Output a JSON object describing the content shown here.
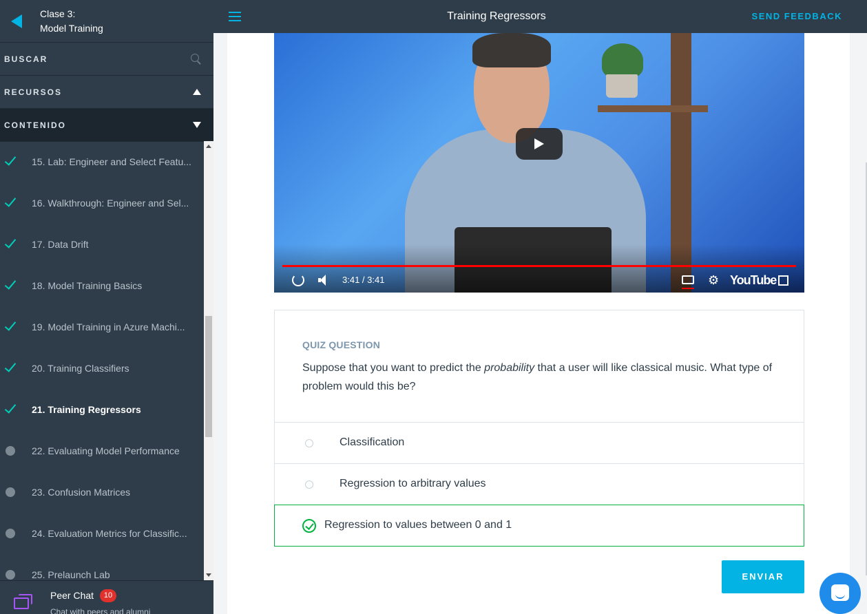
{
  "sidebar": {
    "header": {
      "line1": "Clase 3:",
      "line2": "Model Training"
    },
    "search_label": "BUSCAR",
    "resources_label": "RECURSOS",
    "content_label": "CONTENIDO",
    "lessons": [
      {
        "label": "15. Lab: Engineer and Select Featu...",
        "status": "done"
      },
      {
        "label": "16. Walkthrough: Engineer and Sel...",
        "status": "done"
      },
      {
        "label": "17. Data Drift",
        "status": "done"
      },
      {
        "label": "18. Model Training Basics",
        "status": "done"
      },
      {
        "label": "19. Model Training in Azure Machi...",
        "status": "done"
      },
      {
        "label": "20. Training Classifiers",
        "status": "done"
      },
      {
        "label": "21. Training Regressors",
        "status": "active"
      },
      {
        "label": "22. Evaluating Model Performance",
        "status": "todo"
      },
      {
        "label": "23. Confusion Matrices",
        "status": "todo"
      },
      {
        "label": "24. Evaluation Metrics for Classific...",
        "status": "todo"
      },
      {
        "label": "25. Prelaunch Lab",
        "status": "todo"
      }
    ],
    "peer_chat": {
      "title": "Peer Chat",
      "badge": "10",
      "subtitle": "Chat with peers and alumni"
    }
  },
  "topbar": {
    "title": "Training Regressors",
    "feedback": "SEND FEEDBACK"
  },
  "video": {
    "time": "3:41 / 3:41",
    "logo": "YouTube",
    "progress": 1.0
  },
  "quiz": {
    "label": "QUIZ QUESTION",
    "text_before": "Suppose that you want to predict the ",
    "text_em": "probability",
    "text_after": " that a user will like classical music. What type of problem would this be?",
    "options": [
      {
        "label": "Classification",
        "selected": false
      },
      {
        "label": "Regression to arbitrary values",
        "selected": false
      },
      {
        "label": "Regression to values between 0 and 1",
        "selected": true
      }
    ],
    "submit": "ENVIAR"
  },
  "colors": {
    "accent": "#02b3e4",
    "success": "#02b340",
    "sidebar_bg": "#2e3d49"
  }
}
